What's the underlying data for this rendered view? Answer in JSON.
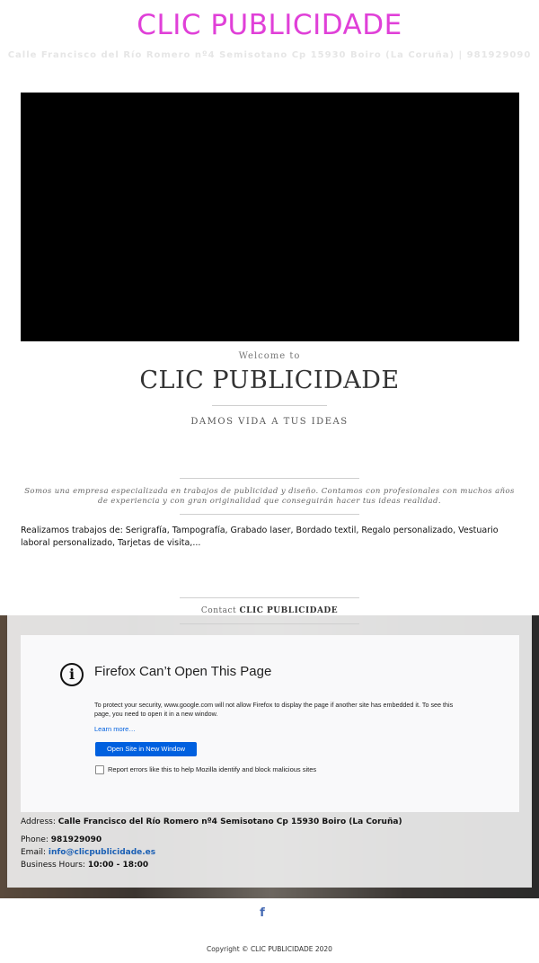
{
  "header": {
    "title": "CLIC PUBLICIDADE",
    "address_line": "Calle Francisco del Río Romero nº4 Semisotano Cp 15930 Boiro (La Coruña) | 981929090"
  },
  "hero": {
    "welcome": "Welcome to",
    "title": "CLIC PUBLICIDADE",
    "tagline": "DAMOS VIDA A TUS IDEAS"
  },
  "about": {
    "text": "Somos una empresa especializada en trabajos de publicidad y diseño. Contamos con profesionales con muchos años de experiencia y con gran originalidad que conseguirán hacer tus ideas realidad.",
    "works": "Realizamos trabajos de: Serigrafía, Tampografía, Grabado laser, Bordado textil, Regalo personalizado, Vestuario laboral personalizado, Tarjetas de visita,..."
  },
  "contact": {
    "label": "Contact",
    "name": "CLIC PUBLICIDADE",
    "address_label": "Address:",
    "address": "Calle Francisco del Río Romero nº4 Semisotano Cp 15930 Boiro (La Coruña)",
    "phone_label": "Phone:",
    "phone": "981929090",
    "email_label": "Email:",
    "email": "info@clicpublicidade.es",
    "hours_label": "Business Hours:",
    "hours": "10:00 - 18:00"
  },
  "map_error": {
    "title": "Firefox Can’t Open This Page",
    "message": "To protect your security, www.google.com will not allow Firefox to display the page if another site has embedded it. To see this page, you need to open it in a new window.",
    "learn_more": "Learn more…",
    "button": "Open Site in New Window",
    "checkbox_label": "Report errors like this to help Mozilla identify and block malicious sites"
  },
  "footer": {
    "social_icon": "facebook-icon",
    "copyright": "Copyright © CLIC PUBLICIDADE 2020"
  },
  "colors": {
    "brand": "#e040d8",
    "link": "#0060df"
  }
}
